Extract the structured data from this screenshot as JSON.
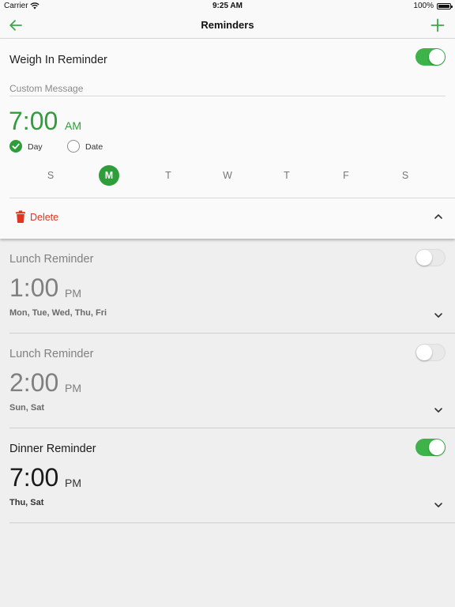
{
  "status_bar": {
    "carrier": "Carrier",
    "time": "9:25 AM",
    "battery_percent": "100%",
    "battery_level": 1.0
  },
  "nav": {
    "title": "Reminders",
    "back_icon": "arrow-left-icon",
    "add_icon": "plus-icon",
    "accent_color": "#3aa849"
  },
  "expanded_reminder": {
    "name": "Weigh In Reminder",
    "enabled": true,
    "custom_message_placeholder": "Custom Message",
    "custom_message_value": "",
    "time": "7:00",
    "period": "AM",
    "schedule_options": [
      {
        "label": "Day",
        "selected": true
      },
      {
        "label": "Date",
        "selected": false
      }
    ],
    "days": [
      {
        "label": "S",
        "selected": false
      },
      {
        "label": "M",
        "selected": true
      },
      {
        "label": "T",
        "selected": false
      },
      {
        "label": "W",
        "selected": false
      },
      {
        "label": "T",
        "selected": false
      },
      {
        "label": "F",
        "selected": false
      },
      {
        "label": "S",
        "selected": false
      }
    ],
    "delete_label": "Delete",
    "delete_icon": "trash-icon",
    "collapse_icon": "chevron-up-icon"
  },
  "reminders": [
    {
      "name": "Lunch Reminder",
      "enabled": false,
      "time": "1:00",
      "period": "PM",
      "days": "Mon, Tue, Wed, Thu, Fri"
    },
    {
      "name": "Lunch Reminder",
      "enabled": false,
      "time": "2:00",
      "period": "PM",
      "days": "Sun, Sat"
    },
    {
      "name": "Dinner Reminder",
      "enabled": true,
      "time": "7:00",
      "period": "PM",
      "days": "Thu, Sat"
    }
  ],
  "colors": {
    "accent_green": "#2f9e3a",
    "toggle_on": "#3db34a",
    "delete_red": "#e4331f"
  }
}
